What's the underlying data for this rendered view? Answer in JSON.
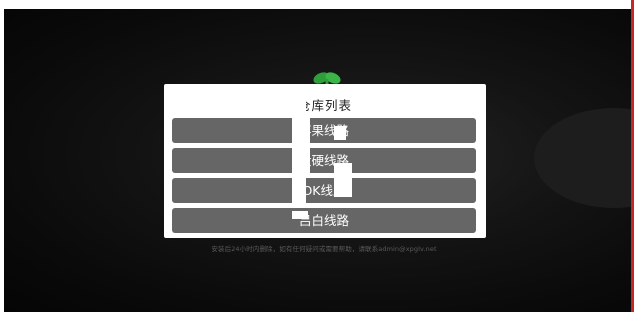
{
  "dialog": {
    "title": "仓库列表",
    "options": [
      {
        "label": "苹果线路"
      },
      {
        "label": "大硬线路"
      },
      {
        "label": "OK线路"
      },
      {
        "label": "吕白线路"
      }
    ]
  },
  "background": {
    "notice": "安装后24小时内删除，如有任何疑问或需要帮助，请联系admin@xpglv.net"
  },
  "colors": {
    "option_bg": "#666666",
    "dialog_bg": "#ffffff",
    "screen_bg": "#0a0a0a",
    "edge_accent": "#c62828"
  },
  "icons": {
    "app_logo": "green-sprout-logo-icon"
  }
}
